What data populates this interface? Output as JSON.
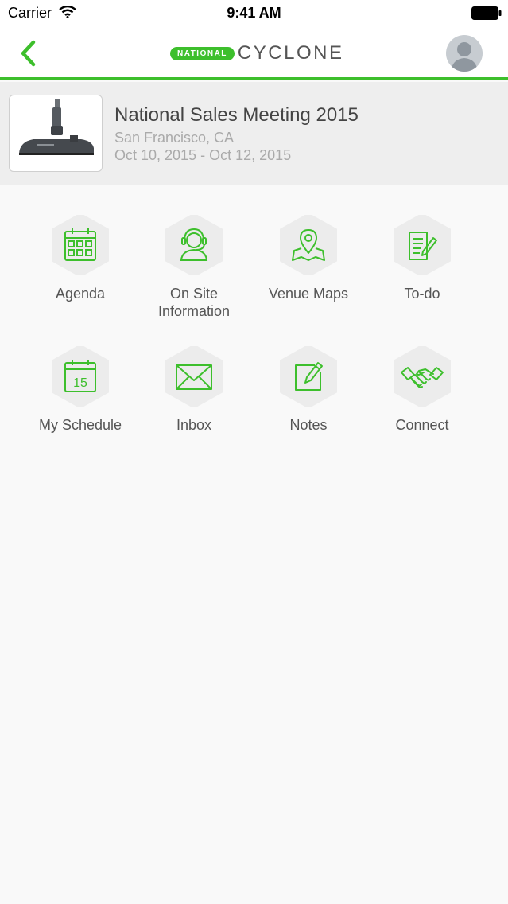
{
  "status_bar": {
    "carrier": "Carrier",
    "time": "9:41 AM"
  },
  "nav": {
    "logo_badge": "NATIONAL",
    "logo_word": "CYCLONE",
    "accent_color": "#3dbf2c"
  },
  "event": {
    "title": "National Sales Meeting 2015",
    "location": "San Francisco, CA",
    "dates": "Oct 10, 2015 - Oct 12, 2015",
    "image": "vacuum-cleaner-head"
  },
  "menu": {
    "items": [
      {
        "label": "Agenda",
        "icon": "calendar-grid-icon"
      },
      {
        "label": "On Site\nInformation",
        "icon": "headset-person-icon"
      },
      {
        "label": "Venue Maps",
        "icon": "map-pin-icon"
      },
      {
        "label": "To-do",
        "icon": "checklist-edit-icon"
      },
      {
        "label": "My Schedule",
        "icon": "calendar-15-icon"
      },
      {
        "label": "Inbox",
        "icon": "envelope-icon"
      },
      {
        "label": "Notes",
        "icon": "note-pencil-icon"
      },
      {
        "label": "Connect",
        "icon": "handshake-icon"
      }
    ],
    "calendar_day": "15"
  }
}
